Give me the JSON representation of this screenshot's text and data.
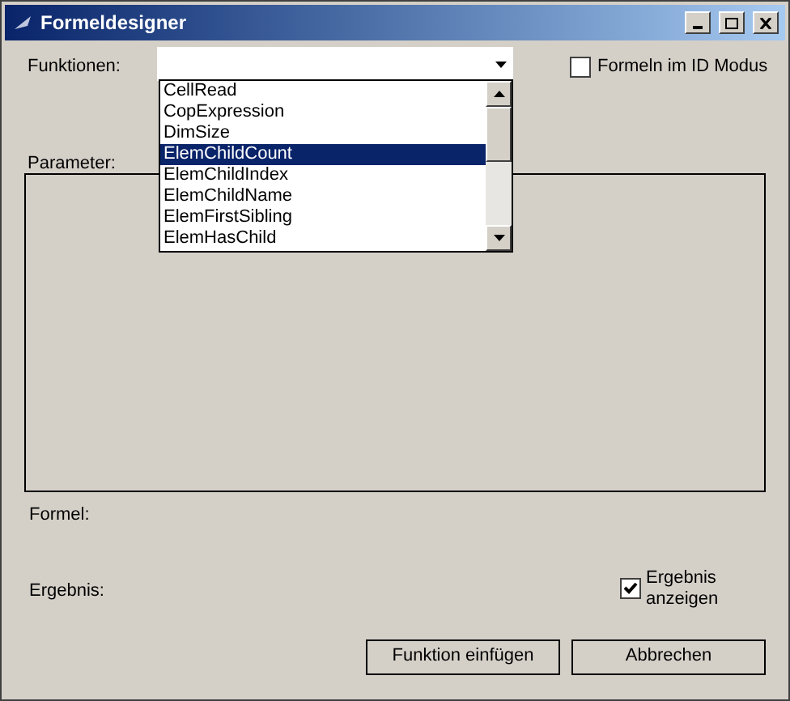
{
  "window": {
    "title": "Formeldesigner"
  },
  "functions": {
    "label": "Funktionen:",
    "expanded": true,
    "options": [
      {
        "label": "CellRead",
        "selected": false
      },
      {
        "label": "CopExpression",
        "selected": false
      },
      {
        "label": "DimSize",
        "selected": false
      },
      {
        "label": "ElemChildCount",
        "selected": true
      },
      {
        "label": "ElemChildIndex",
        "selected": false
      },
      {
        "label": "ElemChildName",
        "selected": false
      },
      {
        "label": "ElemFirstSibling",
        "selected": false
      },
      {
        "label": "ElemHasChild",
        "selected": false
      }
    ]
  },
  "id_mode": {
    "label": "Formeln im ID Modus",
    "checked": false
  },
  "parameter": {
    "label": "Parameter:"
  },
  "formula": {
    "label": "Formel:"
  },
  "result": {
    "label": "Ergebnis:"
  },
  "show_result": {
    "label": "Ergebnis anzeigen",
    "checked": true
  },
  "buttons": [
    "Funktion einfügen",
    "Abbrechen"
  ]
}
